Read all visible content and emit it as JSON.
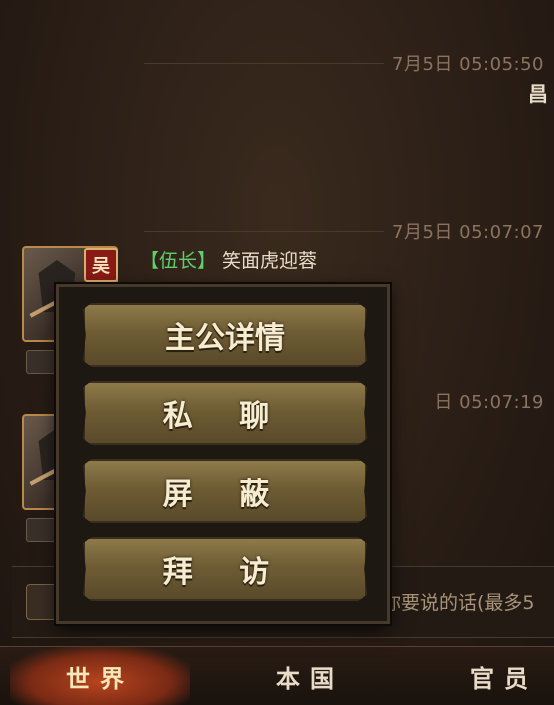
{
  "chat": {
    "timestamps": [
      "7月5日 05:05:50",
      "7月5日 05:07:07",
      "日 05:07:19"
    ],
    "right_sender_fragment": "昌",
    "message": {
      "country_badge": "吴",
      "rank": "【伍长】",
      "name": "笑面虎迎蓉"
    },
    "second_avatar_badge": ""
  },
  "popup_menu": {
    "items": [
      "主公详情",
      "私  聊",
      "屏  蔽",
      "拜  访"
    ]
  },
  "input": {
    "placeholder": "你要说的话(最多5"
  },
  "bottom_nav": {
    "tabs": [
      "世界",
      "本国",
      "官员"
    ],
    "active": "世界"
  },
  "colors": {
    "background": "#2a1e16",
    "rank_green": "#5fd06a",
    "button_gold": "#8e7a4a",
    "active_tab_red": "#b8441e"
  }
}
